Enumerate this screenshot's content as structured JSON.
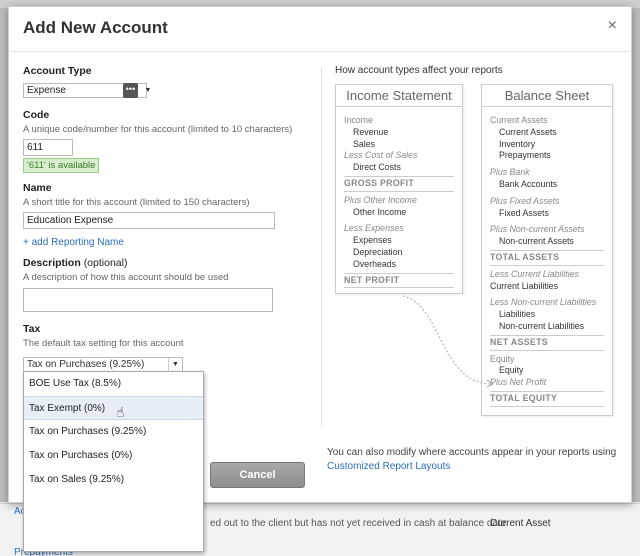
{
  "background": {
    "row_link": "Ac",
    "row_desc": "ed out to the client but has not yet received in cash at balance",
    "row_desc2": "date",
    "row_type": "Current Asset",
    "row_link2": "Prepayments"
  },
  "modal": {
    "title": "Add New Account",
    "close_label": "×"
  },
  "form": {
    "account_type": {
      "label": "Account Type",
      "value": "Expense"
    },
    "code": {
      "label": "Code",
      "help": "A unique code/number for this account (limited to 10 characters)",
      "value": "611",
      "available": "'611' is available"
    },
    "name": {
      "label": "Name",
      "help": "A short title for this account (limited to 150 characters)",
      "value": "Education Expense",
      "add_reporting_name": "+ add Reporting Name"
    },
    "description": {
      "label": "Description",
      "optional": "(optional)",
      "help": "A description of how this account should be used",
      "value": ""
    },
    "tax": {
      "label": "Tax",
      "help": "The default tax setting for this account",
      "value": "Tax on Purchases (9.25%)",
      "options": [
        "BOE Use Tax (8.5%)",
        "Tax Exempt (0%)",
        "Tax on Purchases (9.25%)",
        "Tax on Purchases (0%)",
        "Tax on Sales (9.25%)"
      ]
    },
    "cancel_label": "Cancel"
  },
  "report_panel": {
    "title": "How account types affect your reports",
    "income_statement": {
      "heading": "Income Statement",
      "revenue_group": "Income",
      "revenue_items": [
        "Revenue",
        "Sales"
      ],
      "cost_group": "Less Cost of Sales",
      "cost_items": [
        "Direct Costs"
      ],
      "gross_profit": "GROSS PROFIT",
      "other_group": "Plus Other Income",
      "other_items": [
        "Other Income"
      ],
      "expense_group": "Less Expenses",
      "expense_items": [
        "Expenses",
        "Depreciation",
        "Overheads"
      ],
      "net_profit": "NET PROFIT"
    },
    "balance_sheet": {
      "heading": "Balance Sheet",
      "ca_group": "Current Assets",
      "ca_items": [
        "Current Assets",
        "Inventory",
        "Prepayments"
      ],
      "bank_group": "Plus Bank",
      "bank_items": [
        "Bank Accounts"
      ],
      "fixed_group": "Plus Fixed Assets",
      "fixed_items": [
        "Fixed Assets"
      ],
      "nca_group": "Plus Non-current Assets",
      "nca_items": [
        "Non-current Assets"
      ],
      "total_assets": "TOTAL ASSETS",
      "cl_group": "Less Current Liabilities",
      "cl_items": [
        "Current Liabilities"
      ],
      "ncl_group": "Less Non-current Liabilities",
      "ncl_items": [
        "Liabilities",
        "Non-current Liabilities"
      ],
      "net_assets": "NET ASSETS",
      "equity_group": "Equity",
      "equity_items": [
        "Equity"
      ],
      "net_profit_line": "Plus Net Profit",
      "total_equity": "TOTAL EQUITY"
    },
    "footnote_text": "You can also modify where accounts appear in your reports using",
    "footnote_link": "Customized Report Layouts"
  }
}
